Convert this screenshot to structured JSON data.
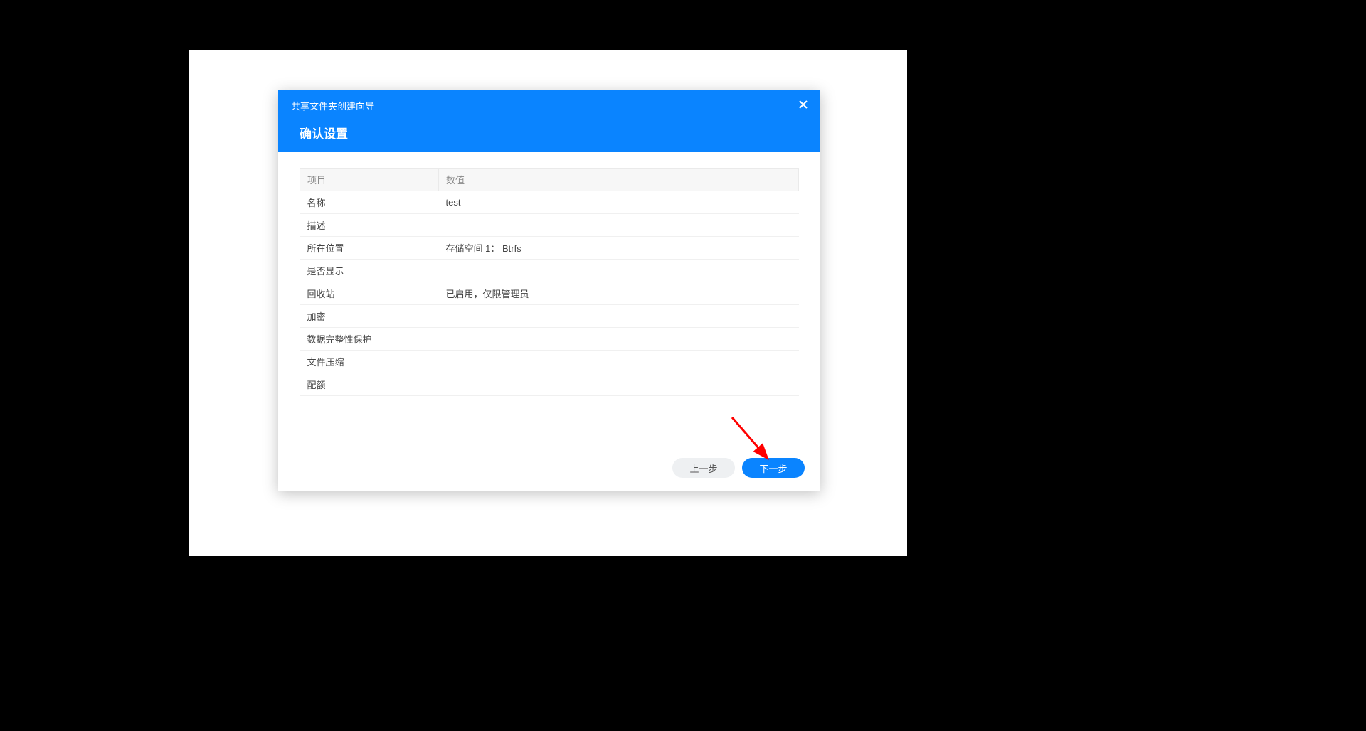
{
  "dialog": {
    "wizard_title": "共享文件夹创建向导",
    "subtitle": "确认设置",
    "table": {
      "headers": {
        "item": "项目",
        "value": "数值"
      },
      "rows": [
        {
          "label": "名称",
          "value": "test"
        },
        {
          "label": "描述",
          "value": ""
        },
        {
          "label": "所在位置",
          "value": "存储空间 1： Btrfs"
        },
        {
          "label": "是否显示",
          "value": ""
        },
        {
          "label": "回收站",
          "value": "已启用，仅限管理员"
        },
        {
          "label": "加密",
          "value": ""
        },
        {
          "label": "数据完整性保护",
          "value": ""
        },
        {
          "label": "文件压缩",
          "value": ""
        },
        {
          "label": "配额",
          "value": ""
        }
      ]
    },
    "buttons": {
      "prev": "上一步",
      "next": "下一步"
    }
  }
}
